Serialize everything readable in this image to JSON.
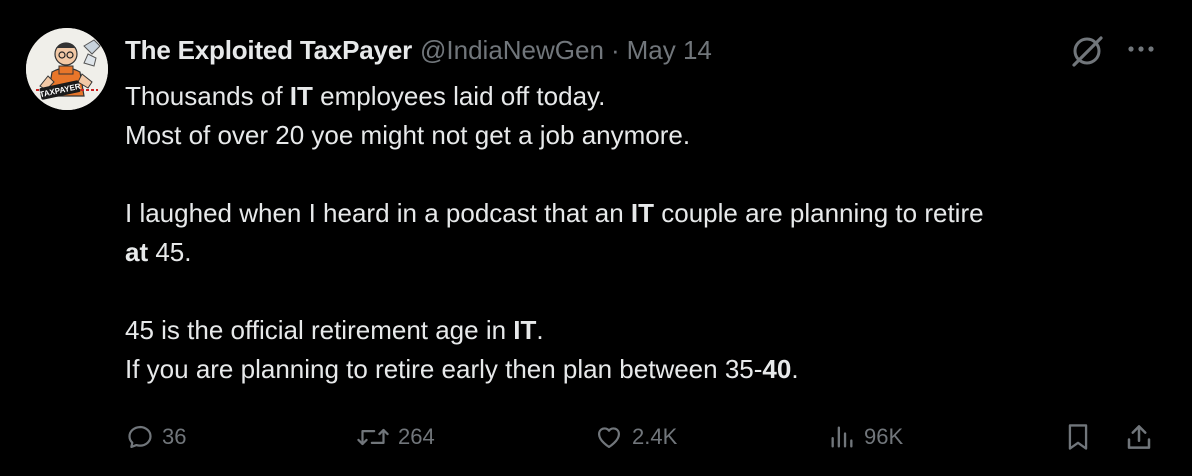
{
  "author": {
    "name": "The Exploited TaxPayer",
    "handle": "@IndiaNewGen",
    "separator": "·",
    "date": "May 14",
    "avatar_caption": "TAXPAYER"
  },
  "body": {
    "lines": [
      [
        {
          "t": "Thousands of ",
          "b": false
        },
        {
          "t": "IT",
          "b": true
        },
        {
          "t": " employees laid off today.",
          "b": false
        }
      ],
      [
        {
          "t": "Most of over 20 yoe might not get a job anymore.",
          "b": false
        }
      ],
      [],
      [
        {
          "t": "I laughed when I heard in a podcast that an ",
          "b": false
        },
        {
          "t": "IT",
          "b": true
        },
        {
          "t": " couple are planning to retire",
          "b": false
        }
      ],
      [
        {
          "t": "at",
          "b": true
        },
        {
          "t": " 45.",
          "b": false
        }
      ],
      [],
      [
        {
          "t": "45 is the official retirement age in ",
          "b": false
        },
        {
          "t": "IT",
          "b": true
        },
        {
          "t": ".",
          "b": false
        }
      ],
      [
        {
          "t": "If you are planning to retire early then plan between 35-",
          "b": false
        },
        {
          "t": "40",
          "b": true
        },
        {
          "t": ".",
          "b": false
        }
      ]
    ]
  },
  "actions": {
    "replies": "36",
    "reposts": "264",
    "likes": "2.4K",
    "views": "96K"
  },
  "icons": {
    "reply": "reply-icon",
    "repost": "repost-icon",
    "like": "heart-icon",
    "views": "views-icon",
    "bookmark": "bookmark-icon",
    "share": "share-icon",
    "grok": "grok-icon",
    "more": "more-icon"
  },
  "colors": {
    "background": "#000000",
    "text": "#e7e9ea",
    "muted": "#71767b"
  }
}
